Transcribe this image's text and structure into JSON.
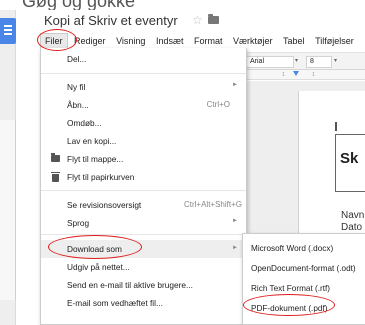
{
  "doc": {
    "title": "Kopi af Skriv et eventyr"
  },
  "icons": {
    "star": "star-icon",
    "folder": "folder-icon",
    "trash": "trash-icon",
    "submenu_arrow": "chevron-right-icon"
  },
  "menubar": {
    "items": [
      "Filer",
      "Rediger",
      "Visning",
      "Indsæt",
      "Format",
      "Værktøjer",
      "Tabel",
      "Tilføjelser"
    ]
  },
  "toolbar": {
    "font": "Arial",
    "size": "8"
  },
  "ruler": {
    "mark1": "1",
    "mark2": "1"
  },
  "file_menu": {
    "share": "Del...",
    "new_file": "Ny fil",
    "open": "Åbn...",
    "open_shortcut": "Ctrl+O",
    "rename": "Omdøb...",
    "make_copy": "Lav en kopi...",
    "move_to_folder": "Flyt til mappe...",
    "move_to_trash": "Flyt til papirkurven",
    "revision_history": "Se revisionsoversigt",
    "revision_shortcut": "Ctrl+Alt+Shift+G",
    "language": "Sprog",
    "download_as": "Download som",
    "publish": "Udgiv på nettet...",
    "email_collaborators": "Send en e-mail til aktive brugere...",
    "email_attachment": "E-mail som vedhæftet fil..."
  },
  "download_menu": {
    "items": [
      "Microsoft Word (.docx)",
      "OpenDocument-format (.odt)",
      "Rich Text Format (.rtf)",
      "PDF-dokument (.pdf)"
    ]
  },
  "document_content": {
    "cursor_line": "I",
    "heading": "Sk",
    "line1": "Navn",
    "line2": "Dato"
  },
  "colors": {
    "annotation_red": "#e01b1b",
    "docs_blue": "#4a86e8",
    "highlight": "#eeeeee"
  }
}
